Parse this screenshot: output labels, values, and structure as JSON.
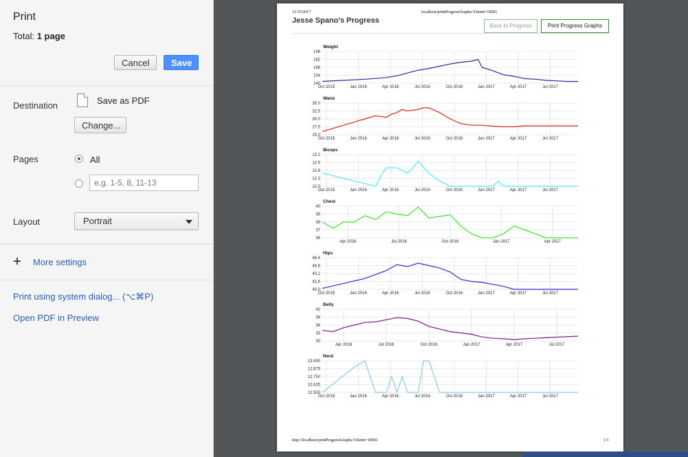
{
  "dialog": {
    "title": "Print",
    "total_label": "Total:",
    "total_value": "1 page",
    "cancel_label": "Cancel",
    "save_label": "Save"
  },
  "destination": {
    "label": "Destination",
    "value": "Save as PDF",
    "change_label": "Change..."
  },
  "pages": {
    "label": "Pages",
    "all_label": "All",
    "custom_placeholder": "e.g. 1-5, 8, 11-13"
  },
  "layout": {
    "label": "Layout",
    "value": "Portrait"
  },
  "more_settings": "More settings",
  "links": {
    "system_dialog": "Print using system dialog... (⌥⌘P)",
    "open_pdf": "Open PDF in Preview"
  },
  "preview": {
    "header_date": "11/15/2017",
    "header_url": "localhost/printProgressGraphs/?clientt=18581",
    "page_title": "Jesse Spano's Progress",
    "back_button": "Back to Progress",
    "print_button": "Print Progress Graphs",
    "footer_url": "http://localhost/printProgressGraphs/?clientt=18581",
    "footer_page": "1/1"
  },
  "colors": {
    "save_blue": "#4d90fe",
    "link_blue": "#2a5db0",
    "button_border_green": "#2e8b3c"
  },
  "chart_data": [
    {
      "type": "line",
      "title": "Weight",
      "color": "#1f2a9e",
      "ylim": [
        140,
        196
      ],
      "yticks": [
        "196",
        "182",
        "168",
        "154",
        "140"
      ],
      "xticks": [
        "Oct 2015",
        "Jan 2016",
        "Apr 2016",
        "Jul 2016",
        "Oct 2016",
        "Jan 2017",
        "Apr 2017",
        "Jul 2017"
      ],
      "x": [
        0,
        2,
        4,
        6,
        7,
        8,
        9,
        10,
        11,
        12,
        13,
        14,
        14.6,
        15,
        16,
        17,
        18,
        19,
        20,
        21,
        22,
        23,
        24
      ],
      "values": [
        143,
        145,
        147,
        150,
        153,
        158,
        163,
        166,
        170,
        174,
        177,
        179,
        182,
        168,
        162,
        155,
        152,
        148,
        147,
        145,
        144,
        143,
        143
      ]
    },
    {
      "type": "line",
      "title": "Waist",
      "color": "#e02020",
      "ylim": [
        25,
        35
      ],
      "yticks": [
        "35.0",
        "32.5",
        "30.0",
        "27.5",
        "25.0"
      ],
      "xticks": [
        "Oct 2015",
        "Jan 2016",
        "Apr 2016",
        "Jul 2016",
        "Oct 2016",
        "Jan 2017",
        "Apr 2017",
        "Jul 2017"
      ],
      "x": [
        0,
        1,
        2,
        3,
        4,
        5,
        6,
        6.5,
        7,
        7.5,
        8,
        9,
        9.5,
        10,
        11,
        12,
        13,
        14,
        15,
        16,
        17,
        18,
        19,
        20,
        21,
        22,
        23,
        24
      ],
      "values": [
        26,
        27,
        28,
        29,
        30,
        31,
        30.5,
        31.5,
        32,
        33,
        32.5,
        33,
        33.5,
        33.5,
        32,
        30,
        28.5,
        28,
        28,
        27.7,
        27.5,
        27.5,
        27.8,
        27.8,
        27.8,
        27.8,
        27.8,
        27.8
      ]
    },
    {
      "type": "line",
      "title": "Biceps",
      "color": "#4ee8f0",
      "ylim": [
        12,
        13.2
      ],
      "yticks": [
        "13.2",
        "12.9",
        "12.6",
        "12.3",
        "12.0"
      ],
      "xticks": [
        "Oct 2015",
        "Jan 2016",
        "Apr 2016",
        "Jul 2016",
        "Oct 2016",
        "Jan 2017",
        "Apr 2017",
        "Jul 2017"
      ],
      "x": [
        0,
        1,
        2,
        3,
        4,
        5,
        5.5,
        6,
        7,
        8,
        8.5,
        9,
        10,
        11,
        12,
        13,
        14,
        15,
        16,
        16.5,
        17,
        18,
        19,
        20,
        21,
        22,
        23,
        24
      ],
      "values": [
        12.5,
        12.4,
        12.3,
        12.2,
        12.1,
        12.0,
        12.4,
        12.7,
        12.7,
        12.5,
        12.7,
        12.95,
        12.5,
        12.2,
        12.0,
        12.0,
        12.0,
        12.0,
        12.0,
        12.2,
        12.0,
        12.0,
        12.0,
        12.0,
        12.0,
        12.0,
        12.0,
        12.0
      ]
    },
    {
      "type": "line",
      "title": "Chest",
      "color": "#3ee030",
      "ylim": [
        36,
        40
      ],
      "yticks": [
        "40",
        "39",
        "38",
        "37",
        "36"
      ],
      "xticks": [
        "Apr 2016",
        "Jul 2016",
        "Oct 2016",
        "Jan 2017",
        "Apr 2017"
      ],
      "x": [
        0,
        1,
        2,
        3,
        4,
        5,
        6,
        7,
        8,
        9,
        10,
        11,
        12,
        13,
        14,
        15,
        16,
        17,
        18,
        19,
        20,
        21,
        22,
        23,
        24
      ],
      "values": [
        38,
        37.2,
        38,
        38,
        38.8,
        38.3,
        39.3,
        39,
        38.8,
        39.9,
        38.5,
        38.7,
        38.9,
        37.5,
        36.5,
        36,
        36,
        36.5,
        37.5,
        37,
        36.5,
        36,
        36,
        36,
        36
      ]
    },
    {
      "type": "line",
      "title": "Hips",
      "color": "#2a2ad8",
      "ylim": [
        40,
        46.4
      ],
      "yticks": [
        "46.4",
        "44.8",
        "43.2",
        "41.6",
        "40.0"
      ],
      "xticks": [
        "Oct 2015",
        "Jan 2016",
        "Apr 2016",
        "Jul 2016",
        "Oct 2016",
        "Jan 2017",
        "Apr 2017",
        "Jul 2017"
      ],
      "x": [
        0,
        2,
        4,
        6,
        7,
        8,
        9,
        10,
        11,
        12,
        13,
        14,
        15,
        16,
        17,
        18,
        19,
        20,
        21,
        22,
        23,
        24
      ],
      "values": [
        40.2,
        41.2,
        42.2,
        43.8,
        45,
        44.6,
        45.3,
        44.8,
        44.3,
        43.5,
        42,
        41.6,
        41.4,
        41,
        40.6,
        40,
        40,
        40,
        40,
        40,
        40,
        40
      ]
    },
    {
      "type": "line",
      "title": "Belly",
      "color": "#7a1a7a",
      "ylim": [
        30,
        42
      ],
      "yticks": [
        "42",
        "39",
        "36",
        "33",
        "30"
      ],
      "xticks": [
        "Apr 2016",
        "Jul 2016",
        "Oct 2016",
        "Jan 2017",
        "Apr 2017",
        "Jul 2017"
      ],
      "x": [
        0,
        1,
        2,
        3,
        4,
        5,
        6,
        7,
        8,
        9,
        10,
        11,
        12,
        13,
        14,
        15,
        16,
        17,
        18,
        19,
        20,
        21,
        22,
        23,
        24
      ],
      "values": [
        34,
        33.5,
        35,
        36,
        37,
        37.2,
        38,
        38.8,
        38.5,
        37.5,
        35.5,
        34.5,
        33.5,
        33,
        32.5,
        31.5,
        31,
        30.8,
        30.5,
        30.8,
        31,
        31.2,
        31.4,
        31.6,
        31.8
      ]
    },
    {
      "type": "line",
      "title": "Neck",
      "color": "#8fc8e8",
      "ylim": [
        12.5,
        13
      ],
      "yticks": [
        "13.000",
        "12.875",
        "12.750",
        "12.625",
        "12.500"
      ],
      "xticks": [
        "Oct 2015",
        "Jan 2016",
        "Apr 2016",
        "Jul 2016",
        "Oct 2016",
        "Jan 2017",
        "Apr 2017",
        "Jul 2017"
      ],
      "x": [
        0,
        3,
        4,
        5,
        6,
        6.5,
        7,
        7.5,
        8,
        9,
        9.5,
        10,
        11,
        12,
        13,
        14,
        15,
        16,
        17,
        18,
        19,
        20,
        21,
        22,
        23,
        24
      ],
      "values": [
        12.5,
        12.9,
        13,
        12.5,
        12.5,
        12.75,
        12.5,
        12.75,
        12.5,
        12.5,
        13,
        13,
        12.5,
        12.5,
        12.5,
        12.5,
        12.5,
        12.5,
        12.5,
        12.5,
        12.5,
        12.5,
        12.5,
        12.5,
        12.5,
        12.5
      ]
    }
  ]
}
